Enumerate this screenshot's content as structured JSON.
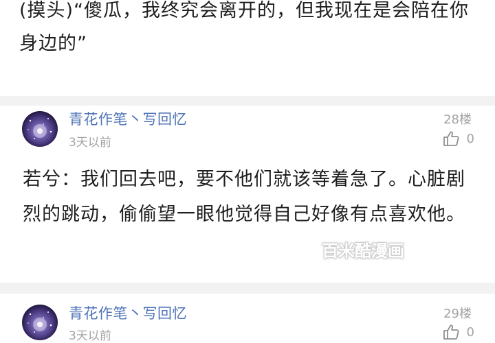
{
  "previous_comment": {
    "text": "(摸头)“傻瓜，我终究会离开的，但我现在是会陪在你身边的”"
  },
  "comments": [
    {
      "username": "青花作笔丶写回忆",
      "time": "3天以前",
      "floor": "28楼",
      "likes": "0",
      "text": "若兮：我们回去吧，要不他们就该等着急了。心脏剧烈的跳动，偷偷望一眼他觉得自己好像有点喜欢他。"
    },
    {
      "username": "青花作笔丶写回忆",
      "time": "3天以前",
      "floor": "29楼",
      "likes": "0"
    }
  ],
  "icons": {
    "like": "thumbs-up-icon",
    "avatar": "galaxy-avatar"
  },
  "watermark": {
    "text": "百米酷漫画"
  },
  "colors": {
    "username": "#4e73b8",
    "meta": "#a3a3a3",
    "divider": "#f2f2f2",
    "text": "#1e1e1e"
  }
}
